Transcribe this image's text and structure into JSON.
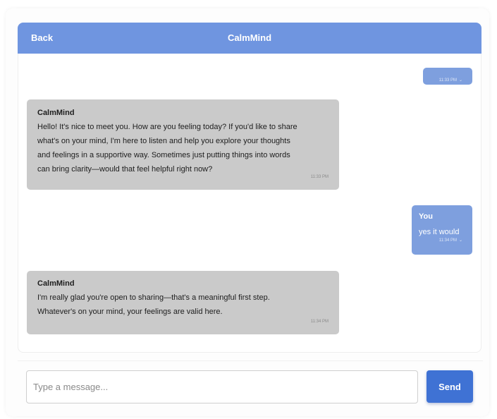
{
  "header": {
    "back_label": "Back",
    "title": "CalmMind"
  },
  "messages": [
    {
      "sender": "",
      "role": "user",
      "text": "",
      "time": "11:33 PM",
      "status": "⌄"
    },
    {
      "sender": "CalmMind",
      "role": "bot",
      "text": "Hello! It's nice to meet you. How are you feeling today? If you'd like to share\nwhat's on your mind, I'm here to listen and help you explore your thoughts\nand feelings in a supportive way. Sometimes just putting things into words\ncan bring clarity—would that feel helpful right now?",
      "time": "11:33 PM"
    },
    {
      "sender": "You",
      "role": "user",
      "text": "yes it would",
      "time": "11:34 PM",
      "status": "⌄"
    },
    {
      "sender": "CalmMind",
      "role": "bot",
      "text": "I'm really glad you're open to sharing—that's a meaningful first step.\nWhatever's on your mind, your feelings are valid here.",
      "time": "11:34 PM"
    }
  ],
  "composer": {
    "placeholder": "Type a message...",
    "value": "",
    "send_label": "Send"
  },
  "colors": {
    "header": "#6f95e0",
    "bot_bubble": "#cacaca",
    "user_bubble": "#7e9fde",
    "send_button": "#3f72d4"
  }
}
